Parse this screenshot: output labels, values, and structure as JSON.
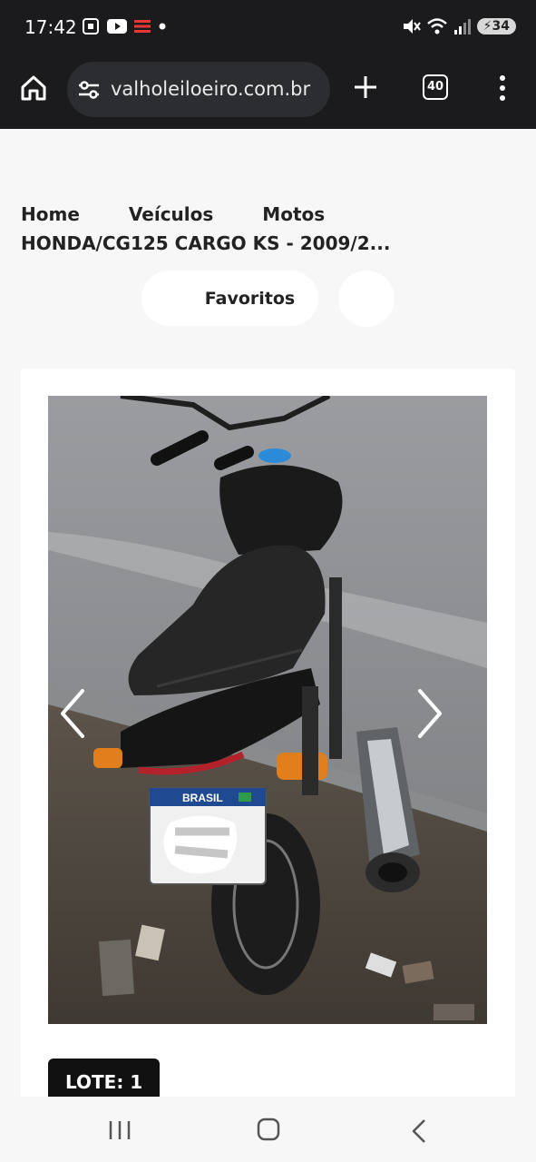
{
  "status_bar": {
    "time": "17:42",
    "battery": "34",
    "icons": [
      "screenshot-icon",
      "youtube-icon",
      "app-icon",
      "dot-icon",
      "mute-icon",
      "wifi-icon",
      "signal-icon",
      "battery-icon"
    ]
  },
  "browser": {
    "url": "valholeiloeiro.com.br",
    "tab_count": "40"
  },
  "breadcrumb": {
    "items": [
      "Home",
      "Veículos",
      "Motos"
    ],
    "product": "HONDA/CG125 CARGO KS - 2009/2..."
  },
  "actions": {
    "favorites_label": "Favoritos"
  },
  "listing": {
    "lote_label": "LOTE: 1",
    "plate_text": "BRASIL"
  },
  "colors": {
    "dark": "#1b1b1d",
    "page_bg": "#f7f7f7",
    "card_bg": "#ffffff",
    "lote_bg": "#111111"
  }
}
